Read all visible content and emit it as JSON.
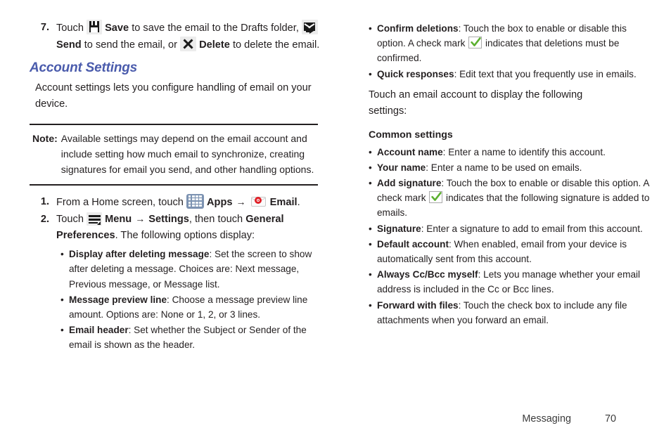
{
  "left_column": {
    "step7": {
      "number": "7.",
      "t1": "Touch ",
      "save_label": "Save",
      "t2": " to save the email to the Drafts folder, ",
      "send_label": "Send",
      "t3": " to send the email, or ",
      "delete_label": "Delete",
      "t4": " to delete the email."
    },
    "section_heading": "Account Settings",
    "intro_paragraph": "Account settings lets you configure handling of email on your device.",
    "note": {
      "label": "Note:",
      "text": "Available settings may depend on the email account and include setting how much email to synchronize, creating signatures for email you send, and other handling options."
    },
    "step1": {
      "number": "1.",
      "t1": "From a Home screen, touch ",
      "apps_label": "Apps",
      "arrow": "→",
      "email_label": "Email",
      "t2": "."
    },
    "step2": {
      "number": "2.",
      "t1": "Touch ",
      "menu_label": "Menu",
      "arrow": "→",
      "settings_label": "Settings",
      "t2": ", then touch ",
      "general_pref_label": "General Preferences",
      "t3": ". The following options display:"
    },
    "bullets": [
      {
        "term": "Display after deleting message",
        "desc": ": Set the screen to show after deleting a message. Choices are: Next message, Previous message, or Message list."
      },
      {
        "term": "Message preview line",
        "desc": ": Choose a message preview line amount. Options are: None or 1, 2, or 3 lines."
      },
      {
        "term": "Email header",
        "desc": ": Set whether the Subject or Sender of the email is shown as the header."
      }
    ]
  },
  "right_column": {
    "confirm_deletions": {
      "term": "Confirm deletions",
      "d1": ": Touch the box to enable or disable this option. A check mark ",
      "d2": " indicates that deletions must be confirmed."
    },
    "quick_responses": {
      "term": "Quick responses",
      "desc": ": Edit text that you frequently use in emails."
    },
    "touch_paragraph": "Touch an email account to display the following settings:",
    "common_settings_heading": "Common settings",
    "account_name": {
      "term": "Account name",
      "desc": ": Enter a name to identify this account."
    },
    "your_name": {
      "term": "Your name",
      "desc": ": Enter a name to be used on emails."
    },
    "add_signature": {
      "term": "Add signature",
      "d1": ": Touch the box to enable or disable this option. A check mark ",
      "d2": " indicates that the following signature is added to emails."
    },
    "bullets": [
      {
        "term": "Signature",
        "desc": ": Enter a signature to add to email from this account."
      },
      {
        "term": "Default account",
        "desc": ": When enabled, email from your device is automatically sent from this account."
      },
      {
        "term": "Always Cc/Bcc myself",
        "desc": ": Lets you manage whether your email address is included in the Cc or Bcc lines."
      },
      {
        "term": "Forward with files",
        "desc": ": Touch the check box to include any file attachments when you forward an email."
      }
    ]
  },
  "footer": {
    "chapter": "Messaging",
    "page_number": "70"
  },
  "bullet_glyph": "•",
  "colors": {
    "heading_blue": "#4a5bac",
    "body_text": "#231f20",
    "check_green": "#5cb030",
    "email_badge_red": "#e02027",
    "apps_blue": "#7d93b2"
  }
}
